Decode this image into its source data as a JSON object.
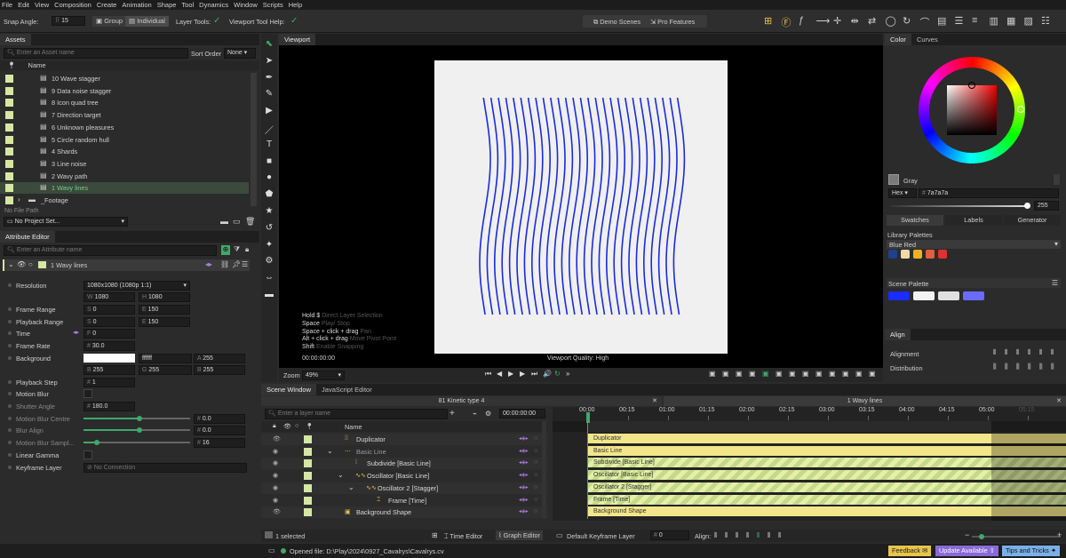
{
  "menu": [
    "File",
    "Edit",
    "View",
    "Composition",
    "Create",
    "Animation",
    "Shape",
    "Tool",
    "Dynamics",
    "Window",
    "Scripts",
    "Help"
  ],
  "toolbar": {
    "snap_label": "Snap Angle:",
    "snap_value": "15",
    "group": "Group",
    "individual": "Individual",
    "layer_tools": "Layer Tools:",
    "viewport_help": "Viewport Tool Help:",
    "demo": "Demo Scenes",
    "pro": "Pro Features"
  },
  "assets": {
    "tab": "Assets",
    "search_placeholder": "Enter an Asset name",
    "sort_label": "Sort Order",
    "sort_value": "None",
    "col_name": "Name",
    "items": [
      "10 Wave stagger",
      "9 Data noise stagger",
      "8 Icon quad tree",
      "7 Direction target",
      "6 Unknown pleasures",
      "5 Circle random hull",
      "4 Shards",
      "3 Line noise",
      "2 Wavy path",
      "1 Wavy lines"
    ],
    "folder": "_Footage",
    "file_path": "No File Path",
    "project": "No Project Set..."
  },
  "attr": {
    "tab": "Attribute Editor",
    "search_placeholder": "Enter an Attribute name",
    "layer": "1 Wavy lines",
    "rows": {
      "resolution": "Resolution",
      "frame_range": "Frame Range",
      "playback_range": "Playback Range",
      "time": "Time",
      "frame_rate": "Frame Rate",
      "background": "Background",
      "playback_step": "Playback Step",
      "motion_blur": "Motion Blur",
      "shutter_angle": "Shutter Angle",
      "mb_centre": "Motion Blur Centre",
      "blur_align": "Blur Align",
      "mb_samples": "Motion Blur Sampl...",
      "linear_gamma": "Linear Gamma",
      "keyframe_layer": "Keyframe Layer"
    },
    "resolution": "1080x1080 (1080p 1:1)",
    "w": "W",
    "w_val": "1080",
    "h": "H",
    "h_val": "1080",
    "s": "S",
    "e": "E",
    "fr_s": "0",
    "fr_e": "150",
    "pr_s": "0",
    "pr_e": "150",
    "f": "F",
    "time_val": "0",
    "fr": "#",
    "rate": "30.0",
    "hex": "ffffff",
    "a": "A",
    "a_val": "255",
    "b": "B",
    "b_val": "255",
    "g": "G",
    "g_val": "255",
    "r_val": "255",
    "step": "1",
    "shutter": "180.0",
    "mbc": "0.0",
    "ba": "0.0",
    "samples": "16",
    "no_conn": "No Connection"
  },
  "viewport": {
    "tab": "Viewport",
    "help_lines": [
      [
        "Hold $",
        "Direct Layer Selection"
      ],
      [
        "Space",
        "Play/ Stop"
      ],
      [
        "Space + click + drag",
        "Pan"
      ],
      [
        "Alt + click + drag",
        "Move Pivot Point"
      ],
      [
        "Shift",
        "Enable Snapping"
      ]
    ],
    "timecode": "00:00:00:00",
    "quality": "Viewport Quality: High",
    "zoom_label": "Zoom",
    "zoom": "49%"
  },
  "color": {
    "tabs": [
      "Color",
      "Curves"
    ],
    "name": "Gray",
    "hex_label": "Hex",
    "hex": "7a7a7a",
    "alpha": "255",
    "subtabs": [
      "Swatches",
      "Labels",
      "Generator"
    ],
    "library": "Library Palettes",
    "palette": "Blue Red",
    "scene": "Scene Palette",
    "palette_colors": [
      "#1f3f8f",
      "#f2d9a6",
      "#f0b020",
      "#e06040",
      "#e03030"
    ],
    "scene_colors": [
      "#1a2cff",
      "#f2f2f2",
      "#e0e0e0",
      "#6a6aff"
    ]
  },
  "align": {
    "tab": "Align",
    "alignment": "Alignment",
    "distribution": "Distribution"
  },
  "scene": {
    "tabs": [
      "Scene Window",
      "JavaScript Editor"
    ],
    "comp_left": "81 Kinetic type 4",
    "comp_right": "1 Wavy lines",
    "search_placeholder": "Enter a layer name",
    "timecode": "00:00:00:00",
    "col_name": "Name",
    "layers": [
      "Duplicator",
      "Basic Line",
      "Subdivide [Basic Line]",
      "Oscillator [Basic Line]",
      "Oscillator 2 [Stagger]",
      "Frame [Time]",
      "Background Shape"
    ],
    "ticks": [
      "00:00",
      "00:15",
      "01:00",
      "01:15",
      "02:00",
      "02:15",
      "03:00",
      "03:15",
      "04:00",
      "04:15",
      "05:00",
      "05:15"
    ],
    "selected": "1 selected",
    "time_editor": "Time Editor",
    "graph_editor": "Graph Editor",
    "keyframe_layer": "Default Keyframe Layer",
    "kf_value": "0",
    "align": "Align:"
  },
  "status": {
    "file": "Opened file: D:\\Play\\2024\\0927_Cavalrys\\Cavalrys.cv",
    "feedback": "Feedback",
    "update": "Update Available",
    "tips": "Tips and Tricks"
  },
  "colors": {
    "accent": "#3fa96b",
    "bar_yellow": "#f3e58a",
    "line_blue": "#1a2ae0"
  }
}
